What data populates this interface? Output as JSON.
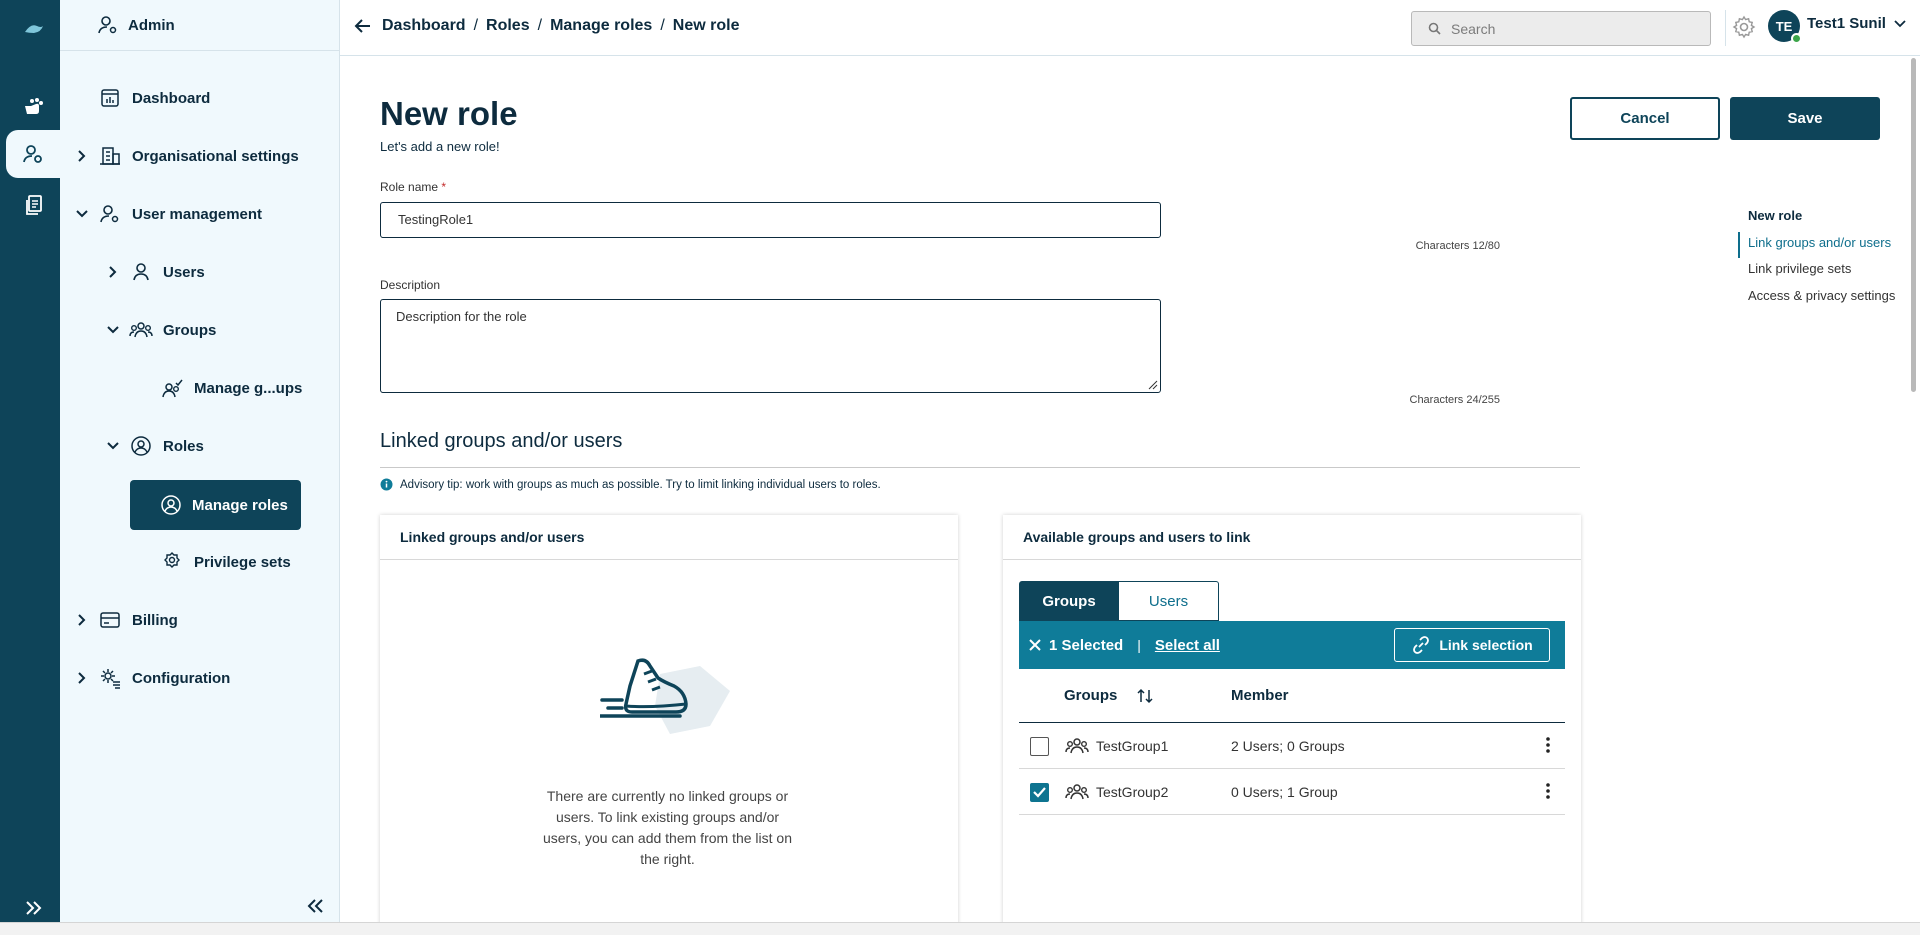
{
  "sidebar": {
    "admin": "Admin",
    "items": [
      {
        "label": "Dashboard"
      },
      {
        "label": "Organisational settings"
      },
      {
        "label": "User management"
      },
      {
        "label": "Users"
      },
      {
        "label": "Groups"
      },
      {
        "label": "Manage g...ups"
      },
      {
        "label": "Roles"
      },
      {
        "label": "Manage roles"
      },
      {
        "label": "Privilege sets"
      },
      {
        "label": "Billing"
      },
      {
        "label": "Configuration"
      }
    ]
  },
  "header": {
    "breadcrumbs": [
      "Dashboard",
      "Roles",
      "Manage roles",
      "New role"
    ],
    "separator": "/",
    "search_placeholder": "Search",
    "avatar_initials": "TE",
    "user_name": "Test1 Sunil"
  },
  "page": {
    "title": "New role",
    "subtitle": "Let's add a new role!",
    "cancel": "Cancel",
    "save": "Save"
  },
  "form": {
    "role_name_label": "Role name",
    "required_mark": "*",
    "role_name_value": "TestingRole1",
    "role_name_counter": "Characters 12/80",
    "description_label": "Description",
    "description_value": "Description for the role",
    "description_counter": "Characters 24/255"
  },
  "linked_section": {
    "title": "Linked groups and/or users",
    "tip": "Advisory tip: work with groups as much as possible. Try to limit linking individual users to roles."
  },
  "linked_panel": {
    "title": "Linked groups and/or users",
    "empty_text": "There are currently no linked groups or users. To link existing groups and/or users, you can add them from the list on the right."
  },
  "available_panel": {
    "title": "Available groups and users to link",
    "tabs": [
      "Groups",
      "Users"
    ],
    "selected": "1 Selected",
    "pipe": "|",
    "select_all": "Select all",
    "link_selection": "Link selection",
    "columns": [
      "Groups",
      "Member"
    ],
    "rows": [
      {
        "name": "TestGroup1",
        "member": "2 Users; 0 Groups",
        "checked": false
      },
      {
        "name": "TestGroup2",
        "member": "0 Users; 1 Group",
        "checked": true
      }
    ]
  },
  "on_this_page": {
    "items": [
      "New role",
      "Link groups and/or users",
      "Link privilege sets",
      "Access & privacy settings"
    ],
    "active": "Link groups and/or users"
  },
  "colors": {
    "primary": "#0e4459",
    "accent": "#0f7c99",
    "sidebar_bg": "#f0f9fd"
  }
}
